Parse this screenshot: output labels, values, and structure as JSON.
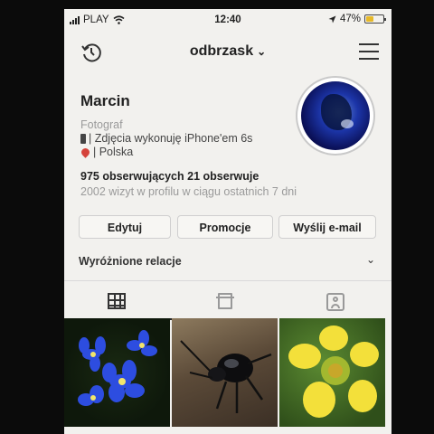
{
  "status_bar": {
    "carrier": "PLAY",
    "time": "12:40",
    "battery": "47%",
    "battery_level": 0.47,
    "battery_color": "#e7b928",
    "icons": [
      "signal-icon",
      "wifi-icon",
      "location-arrow-icon",
      "battery-icon"
    ]
  },
  "header": {
    "username": "odbrzask",
    "left_icon": "history-icon",
    "right_icon": "menu-icon",
    "dropdown_icon": "chevron-down-icon"
  },
  "profile": {
    "name": "Marcin",
    "category": "Fotograf",
    "bio_line1": "| Zdjęcia wykonuję iPhone'em 6s",
    "bio_line2": "| Polska",
    "followers": "975 obserwujących",
    "following": "21 obserwuje",
    "visits": "2002 wizyt w profilu w ciągu ostatnich 7 dni"
  },
  "buttons": {
    "edit": "Edytuj",
    "promote": "Promocje",
    "email": "Wyślij e-mail"
  },
  "highlights": {
    "label": "Wyróżnione relacje"
  },
  "tabs": [
    {
      "icon": "grid-icon",
      "active": true
    },
    {
      "icon": "list-icon",
      "active": false
    },
    {
      "icon": "tagged-icon",
      "active": false
    }
  ],
  "photos": [
    {
      "subject": "blue flowers"
    },
    {
      "subject": "black beetle"
    },
    {
      "subject": "yellow flower"
    }
  ]
}
